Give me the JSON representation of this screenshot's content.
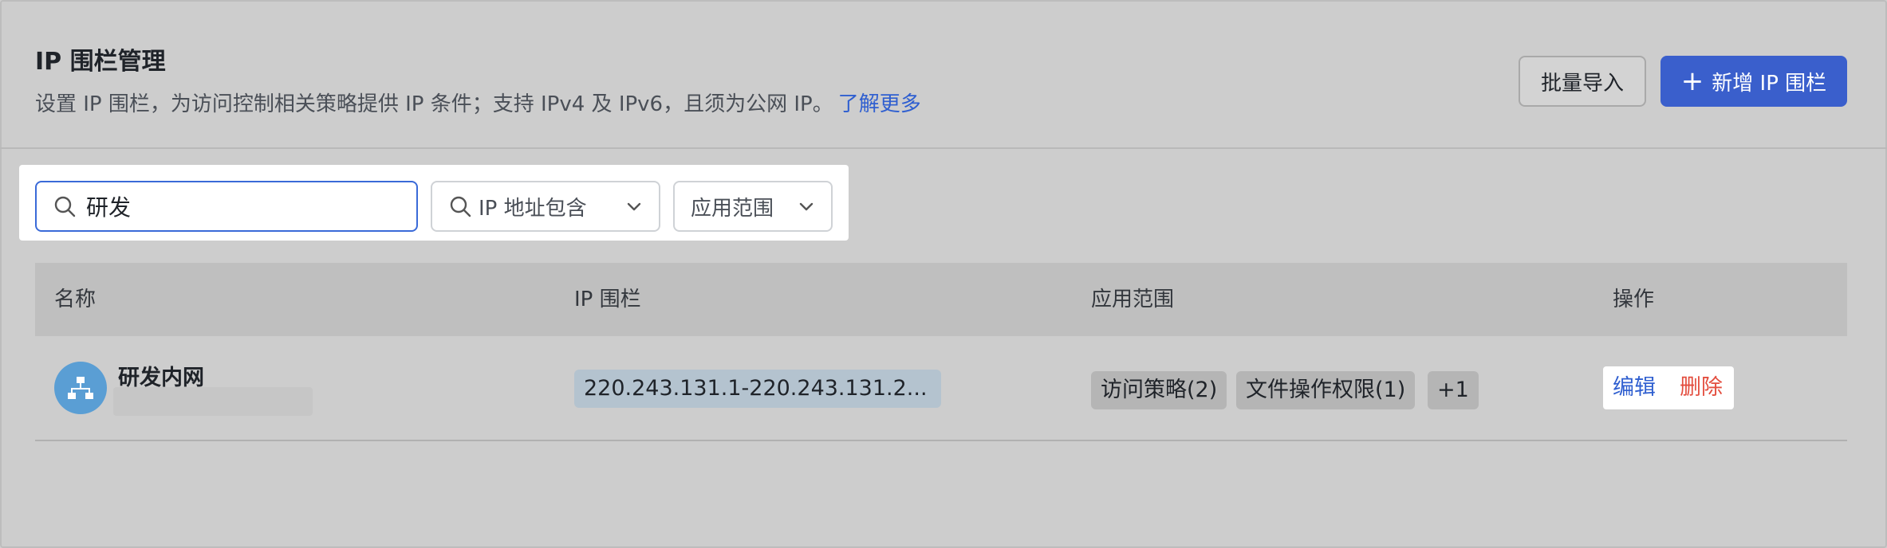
{
  "header": {
    "title": "IP 围栏管理",
    "description": "设置 IP 围栏，为访问控制相关策略提供 IP 条件；支持 IPv4 及 IPv6，且须为公网 IP。",
    "learn_more": "了解更多",
    "batch_import_label": "批量导入",
    "add_label": "新增 IP 围栏",
    "add_icon": "plus-icon"
  },
  "filters": {
    "search_value": "研发",
    "ip_dropdown_label": "IP 地址包含",
    "scope_dropdown_label": "应用范围"
  },
  "table": {
    "columns": [
      "名称",
      "IP 围栏",
      "应用范围",
      "操作"
    ],
    "rows": [
      {
        "name": "研发内网",
        "avatar_icon": "network-icon",
        "ip_range": "220.243.131.1-220.243.131.2...",
        "scope_tags": [
          "访问策略(2)",
          "文件操作权限(1)",
          "+1"
        ],
        "actions": {
          "edit": "编辑",
          "delete": "删除"
        }
      }
    ]
  },
  "colors": {
    "primary": "#3a5fcc",
    "link": "#2f5fd0",
    "danger": "#e34d3e",
    "avatar": "#5a9ed4"
  }
}
